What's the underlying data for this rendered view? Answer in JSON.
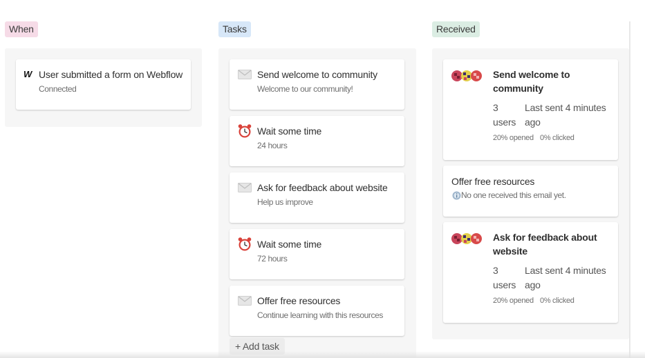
{
  "columns": {
    "when": {
      "label": "When"
    },
    "tasks": {
      "label": "Tasks"
    },
    "received": {
      "label": "Received"
    }
  },
  "trigger": {
    "icon": "webflow-logo-icon",
    "logo_text": "W",
    "title": "User submitted a form on Webflow",
    "status": "Connected"
  },
  "tasks": [
    {
      "icon": "envelope-icon",
      "title": "Send welcome to community",
      "subtitle": "Welcome to our community!"
    },
    {
      "icon": "alarm-clock-icon",
      "title": "Wait some time",
      "subtitle": "24 hours"
    },
    {
      "icon": "envelope-icon",
      "title": "Ask for feedback about website",
      "subtitle": "Help us improve"
    },
    {
      "icon": "alarm-clock-icon",
      "title": "Wait some time",
      "subtitle": "72 hours"
    },
    {
      "icon": "envelope-icon",
      "title": "Offer free resources",
      "subtitle": "Continue learning with this resources"
    }
  ],
  "add_task_label": "+ Add task",
  "received": [
    {
      "title_line1": "Send welcome to",
      "title_line2": "community",
      "users_count": "3",
      "users_label": "users",
      "last_sent_line1": "Last sent 4 minutes",
      "last_sent_line2": "ago",
      "opened": "20% opened",
      "clicked": "0% clicked"
    },
    {
      "title": "Offer free resources",
      "empty_icon": "info-icon",
      "empty_text": "No one received this email yet."
    },
    {
      "title_line1": "Ask for feedback about",
      "title_line2": "website",
      "users_count": "3",
      "users_label": "users",
      "last_sent_line1": "Last sent 4 minutes",
      "last_sent_line2": "ago",
      "opened": "20% opened",
      "clicked": "0% clicked"
    }
  ],
  "colors": {
    "when_tag": "#f6dbe7",
    "tasks_tag": "#d7e7f8",
    "received_tag": "#dbede3",
    "panel_bg": "#f6f6f6",
    "clock_red": "#d9423a"
  }
}
